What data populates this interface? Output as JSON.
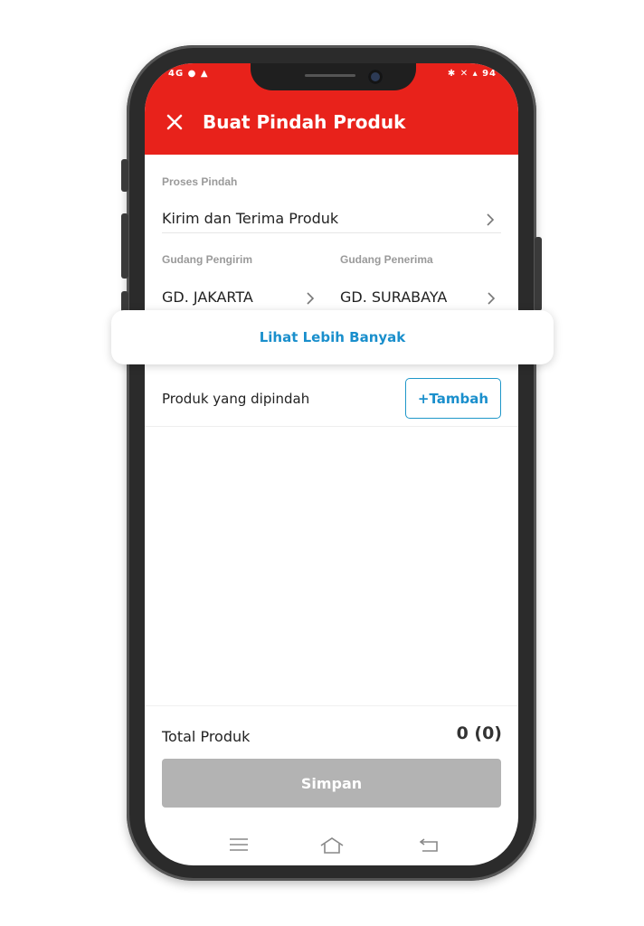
{
  "status_bar": {
    "left": "4G ● ▲",
    "right": "✱ ✕ ▴ 94"
  },
  "header": {
    "title": "Buat Pindah Produk",
    "close_icon": "close-icon"
  },
  "form": {
    "process_label": "Proses Pindah",
    "process_value": "Kirim dan Terima Produk",
    "sender_label": "Gudang Pengirim",
    "sender_value": "GD. JAKARTA",
    "receiver_label": "Gudang Penerima",
    "receiver_value": "GD. SURABAYA",
    "see_more": "Lihat Lebih Banyak"
  },
  "products": {
    "label": "Produk yang dipindah",
    "add_button": "+Tambah"
  },
  "footer": {
    "total_label": "Total Produk",
    "total_value": "0 (0)",
    "save_button": "Simpan"
  },
  "colors": {
    "brand_red": "#e8221b",
    "link_blue": "#1a8fcc",
    "disabled_gray": "#b3b3b3"
  }
}
